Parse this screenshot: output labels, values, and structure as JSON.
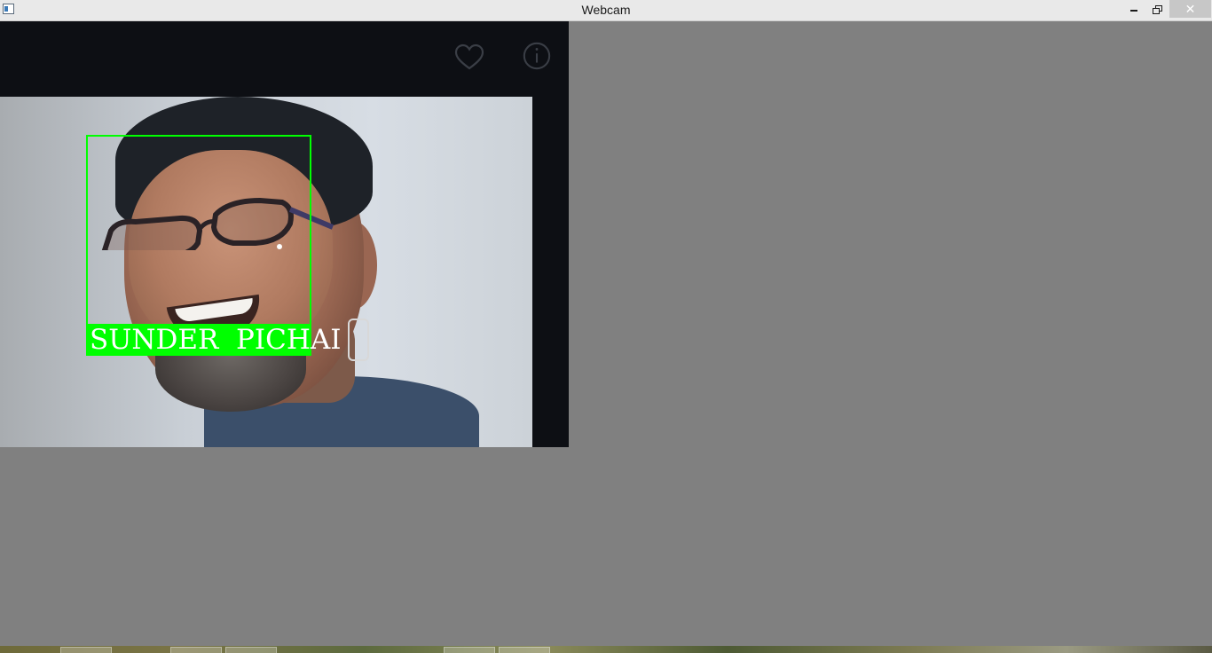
{
  "window": {
    "title": "Webcam",
    "icons": {
      "app": "app-window-icon",
      "minimize": "minimize-icon",
      "maximize": "restore-icon",
      "close": "close-icon"
    },
    "close_glyph": "✕"
  },
  "video": {
    "overlay_icons": [
      "heart-icon",
      "info-icon"
    ],
    "detection": {
      "label": "SUNDER  PICHAI",
      "box_color": "#00ff00",
      "text_color": "#ffffff"
    }
  },
  "colors": {
    "background": "#808080",
    "titlebar": "#e9e9e9"
  }
}
